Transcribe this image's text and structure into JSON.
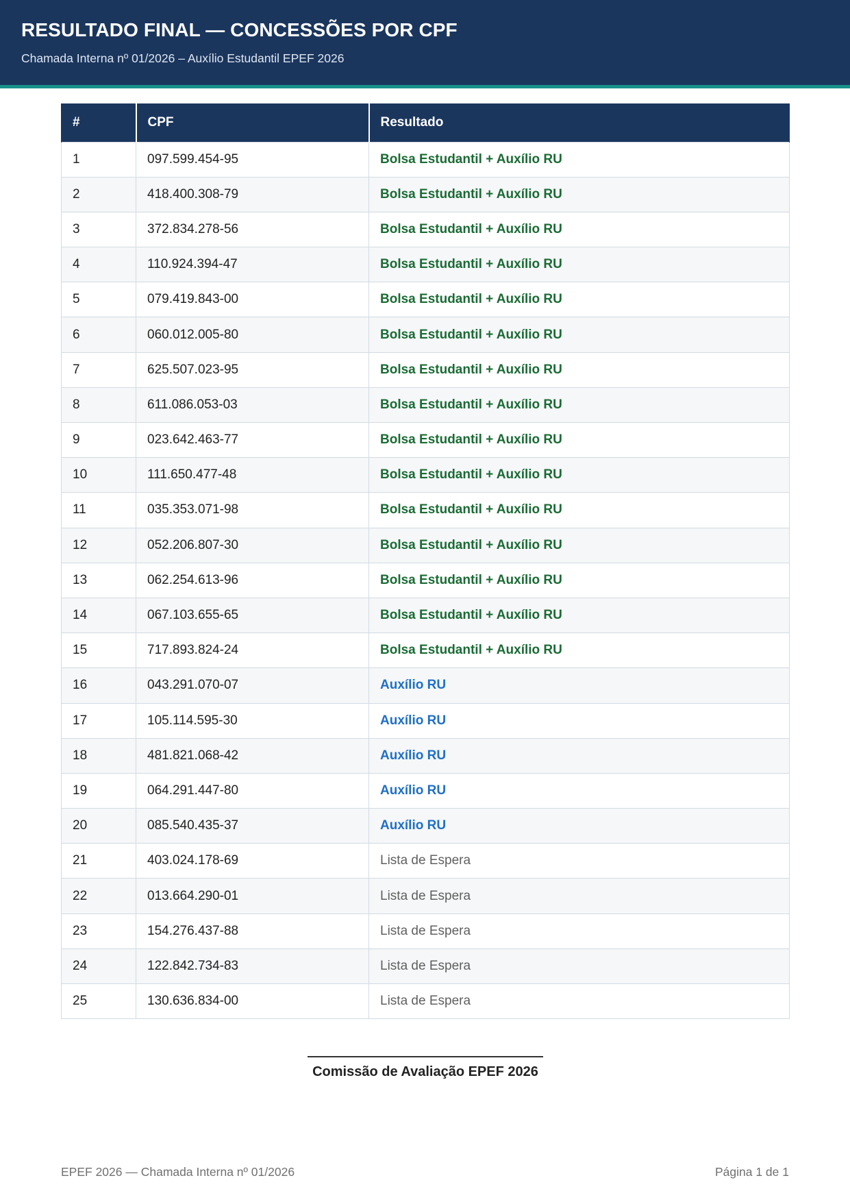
{
  "header": {
    "title": "RESULTADO FINAL — CONCESSÕES POR CPF",
    "subtitle": "Chamada Interna nº 01/2026 – Auxílio Estudantil EPEF 2026"
  },
  "table": {
    "columns": [
      "#",
      "CPF",
      "Resultado"
    ],
    "rows": [
      {
        "n": "1",
        "cpf": "097.599.454-95",
        "result": "Bolsa Estudantil + Auxílio RU",
        "status": "bolsa"
      },
      {
        "n": "2",
        "cpf": "418.400.308-79",
        "result": "Bolsa Estudantil + Auxílio RU",
        "status": "bolsa"
      },
      {
        "n": "3",
        "cpf": "372.834.278-56",
        "result": "Bolsa Estudantil + Auxílio RU",
        "status": "bolsa"
      },
      {
        "n": "4",
        "cpf": "110.924.394-47",
        "result": "Bolsa Estudantil + Auxílio RU",
        "status": "bolsa"
      },
      {
        "n": "5",
        "cpf": "079.419.843-00",
        "result": "Bolsa Estudantil + Auxílio RU",
        "status": "bolsa"
      },
      {
        "n": "6",
        "cpf": "060.012.005-80",
        "result": "Bolsa Estudantil + Auxílio RU",
        "status": "bolsa"
      },
      {
        "n": "7",
        "cpf": "625.507.023-95",
        "result": "Bolsa Estudantil + Auxílio RU",
        "status": "bolsa"
      },
      {
        "n": "8",
        "cpf": "611.086.053-03",
        "result": "Bolsa Estudantil + Auxílio RU",
        "status": "bolsa"
      },
      {
        "n": "9",
        "cpf": "023.642.463-77",
        "result": "Bolsa Estudantil + Auxílio RU",
        "status": "bolsa"
      },
      {
        "n": "10",
        "cpf": "111.650.477-48",
        "result": "Bolsa Estudantil + Auxílio RU",
        "status": "bolsa"
      },
      {
        "n": "11",
        "cpf": "035.353.071-98",
        "result": "Bolsa Estudantil + Auxílio RU",
        "status": "bolsa"
      },
      {
        "n": "12",
        "cpf": "052.206.807-30",
        "result": "Bolsa Estudantil + Auxílio RU",
        "status": "bolsa"
      },
      {
        "n": "13",
        "cpf": "062.254.613-96",
        "result": "Bolsa Estudantil + Auxílio RU",
        "status": "bolsa"
      },
      {
        "n": "14",
        "cpf": "067.103.655-65",
        "result": "Bolsa Estudantil + Auxílio RU",
        "status": "bolsa"
      },
      {
        "n": "15",
        "cpf": "717.893.824-24",
        "result": "Bolsa Estudantil + Auxílio RU",
        "status": "bolsa"
      },
      {
        "n": "16",
        "cpf": "043.291.070-07",
        "result": "Auxílio RU",
        "status": "ru"
      },
      {
        "n": "17",
        "cpf": "105.114.595-30",
        "result": "Auxílio RU",
        "status": "ru"
      },
      {
        "n": "18",
        "cpf": "481.821.068-42",
        "result": "Auxílio RU",
        "status": "ru"
      },
      {
        "n": "19",
        "cpf": "064.291.447-80",
        "result": "Auxílio RU",
        "status": "ru"
      },
      {
        "n": "20",
        "cpf": "085.540.435-37",
        "result": "Auxílio RU",
        "status": "ru"
      },
      {
        "n": "21",
        "cpf": "403.024.178-69",
        "result": "Lista de Espera",
        "status": "espera"
      },
      {
        "n": "22",
        "cpf": "013.664.290-01",
        "result": "Lista de Espera",
        "status": "espera"
      },
      {
        "n": "23",
        "cpf": "154.276.437-88",
        "result": "Lista de Espera",
        "status": "espera"
      },
      {
        "n": "24",
        "cpf": "122.842.734-83",
        "result": "Lista de Espera",
        "status": "espera"
      },
      {
        "n": "25",
        "cpf": "130.636.834-00",
        "result": "Lista de Espera",
        "status": "espera"
      }
    ]
  },
  "colors": {
    "header_bg": "#1b365d",
    "accent_line": "#17918a",
    "bolsa": "#1a6b34",
    "ru": "#1e6fc7",
    "espera": "#606060"
  },
  "signature": {
    "label": "Comissão de Avaliação EPEF 2026"
  },
  "footer": {
    "left": "EPEF 2026 — Chamada Interna nº 01/2026",
    "right": "Página 1 de 1"
  }
}
